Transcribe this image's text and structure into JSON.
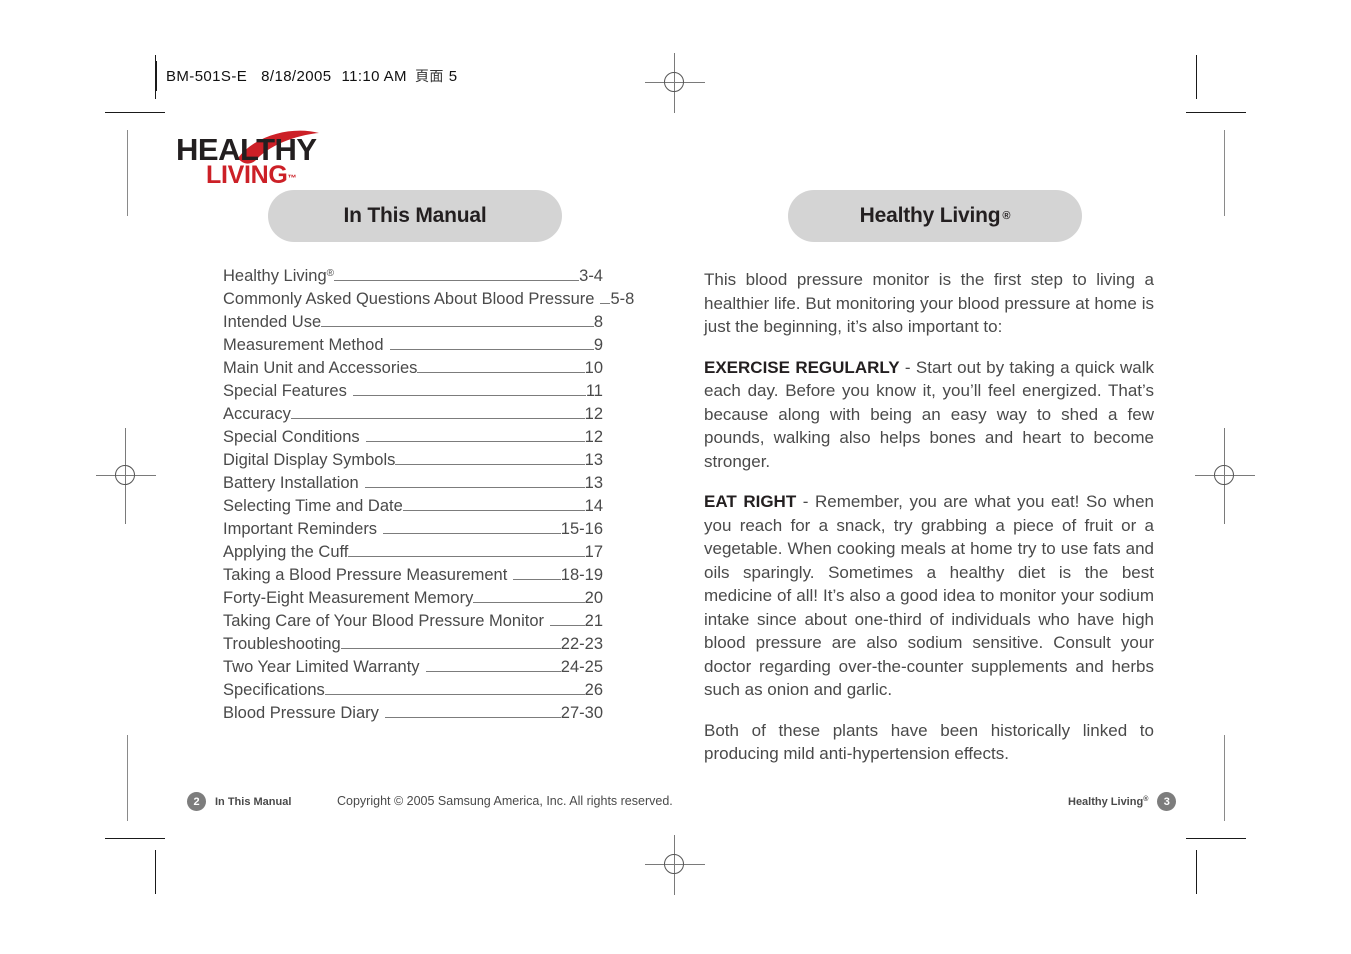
{
  "print_marks": {
    "file_info": {
      "document": "BM-501S-E",
      "date": "8/18/2005",
      "time": "11:10 AM",
      "page_label_cjk": "頁面",
      "page_number": "5"
    }
  },
  "logo": {
    "word_top": "HEALTHY",
    "word_bottom": "LIVING",
    "trademark": "™",
    "color_black": "#231f20",
    "color_red": "#cc2027"
  },
  "left_page": {
    "pill_title": "In This Manual",
    "toc": [
      {
        "title": "Healthy Living",
        "sup": "®",
        "page": "3-4"
      },
      {
        "title": "Commonly Asked Questions About Blood Pressure",
        "sup": "",
        "page": "5-8"
      },
      {
        "title": "Intended Use",
        "sup": "",
        "page": "8"
      },
      {
        "title": "Measurement Method",
        "sup": "",
        "page": "9"
      },
      {
        "title": "Main Unit and Accessories",
        "sup": "",
        "page": "10"
      },
      {
        "title": "Special Features",
        "sup": "",
        "page": "11"
      },
      {
        "title": "Accuracy",
        "sup": "",
        "page": "12"
      },
      {
        "title": "Special Conditions",
        "sup": "",
        "page": "12"
      },
      {
        "title": "Digital Display Symbols",
        "sup": "",
        "page": "13"
      },
      {
        "title": "Battery Installation",
        "sup": "",
        "page": "13"
      },
      {
        "title": "Selecting Time and Date",
        "sup": "",
        "page": "14"
      },
      {
        "title": "Important Reminders",
        "sup": "",
        "page": "15-16"
      },
      {
        "title": "Applying the Cuff",
        "sup": "",
        "page": "17"
      },
      {
        "title": "Taking a Blood Pressure Measurement",
        "sup": "",
        "page": "18-19"
      },
      {
        "title": "Forty-Eight Measurement Memory",
        "sup": "",
        "page": "20"
      },
      {
        "title": "Taking Care of Your Blood Pressure Monitor",
        "sup": "",
        "page": "21"
      },
      {
        "title": "Troubleshooting",
        "sup": "",
        "page": "22-23"
      },
      {
        "title": "Two Year Limited Warranty",
        "sup": "",
        "page": "24-25"
      },
      {
        "title": "Specifications",
        "sup": "",
        "page": "26"
      },
      {
        "title": "Blood Pressure Diary",
        "sup": "",
        "page": "27-30"
      }
    ]
  },
  "right_page": {
    "pill_title": "Healthy Living",
    "pill_title_sup": "®",
    "paragraphs": {
      "intro": "This blood pressure monitor is the first step to living a healthier life. But monitoring your blood pressure at home is just the beginning, it’s also important to:",
      "exercise_term": "EXERCISE REGULARLY",
      "exercise_body": " - Start out by taking a quick walk each day. Before you know it, you’ll feel energized. That’s because along with being an easy way to shed a few pounds, walking also helps bones and heart to become stronger.",
      "eat_right_term": "EAT RIGHT",
      "eat_right_body": " - Remember, you are what you eat! So when you reach for a snack, try grabbing a piece of fruit or a vegetable. When cooking meals at home try to use fats and oils sparingly. Sometimes a healthy diet is the best medicine of all! It’s also a good idea to monitor your sodium intake since about one-third of individuals who have high blood pressure are also sodium sensitive. Consult your doctor regarding over-the-counter supplements and herbs such as onion and garlic.",
      "closing": "Both of these plants have been historically linked to producing mild anti-hypertension effects."
    }
  },
  "footer": {
    "left_page_number": "2",
    "left_label": "In This Manual",
    "copyright": "Copyright © 2005 Samsung America, Inc. All rights reserved.",
    "right_label": "Healthy Living",
    "right_label_sup": "®",
    "right_page_number": "3"
  }
}
